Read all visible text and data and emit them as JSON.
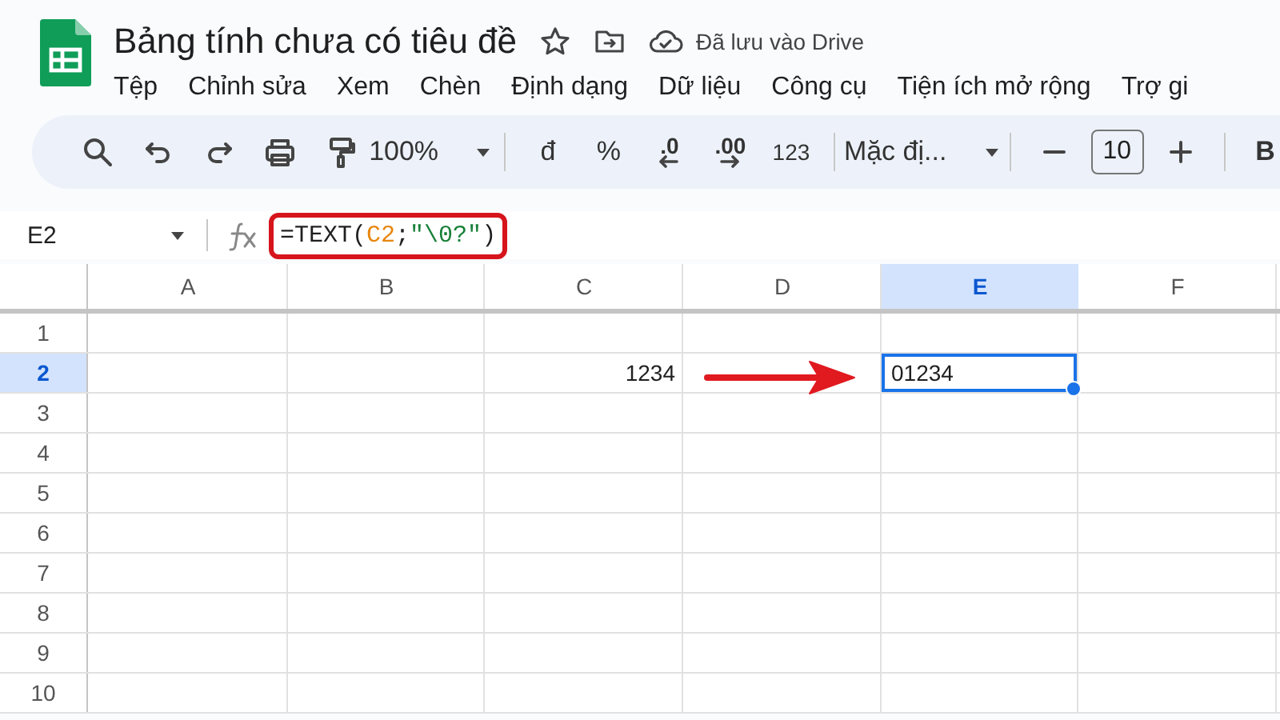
{
  "document": {
    "title": "Bảng tính chưa có tiêu đề",
    "save_status": "Đã lưu vào Drive"
  },
  "menu": [
    "Tệp",
    "Chỉnh sửa",
    "Xem",
    "Chèn",
    "Định dạng",
    "Dữ liệu",
    "Công cụ",
    "Tiện ích mở rộng",
    "Trợ gi"
  ],
  "toolbar": {
    "zoom": "100%",
    "currency": "đ",
    "percent": "%",
    "decrease_decimals": ".0",
    "increase_decimals": ".00",
    "number_format": "123",
    "font": "Mặc đị...",
    "font_size": "10",
    "bold": "B"
  },
  "formula_bar": {
    "name_box": "E2",
    "highlighted": true,
    "formula": [
      {
        "kind": "plain",
        "text": "=TEXT("
      },
      {
        "kind": "ref",
        "text": "C2"
      },
      {
        "kind": "plain",
        "text": ";"
      },
      {
        "kind": "string",
        "text": "\"\\0?\""
      },
      {
        "kind": "plain",
        "text": ")"
      }
    ]
  },
  "sheet": {
    "columns": [
      {
        "label": "A",
        "selected": false
      },
      {
        "label": "B",
        "selected": false
      },
      {
        "label": "C",
        "selected": false
      },
      {
        "label": "D",
        "selected": false
      },
      {
        "label": "E",
        "selected": true
      },
      {
        "label": "F",
        "selected": false
      }
    ],
    "rows": [
      {
        "label": "1",
        "selected": false
      },
      {
        "label": "2",
        "selected": true,
        "cells": {
          "C": {
            "value": "1234",
            "selected": false
          },
          "E": {
            "value": "01234",
            "selected": true
          }
        }
      },
      {
        "label": "3",
        "selected": false
      },
      {
        "label": "4",
        "selected": false
      },
      {
        "label": "5",
        "selected": false
      },
      {
        "label": "6",
        "selected": false
      },
      {
        "label": "7",
        "selected": false
      },
      {
        "label": "8",
        "selected": false
      },
      {
        "label": "9",
        "selected": false
      },
      {
        "label": "10",
        "selected": false
      }
    ]
  }
}
